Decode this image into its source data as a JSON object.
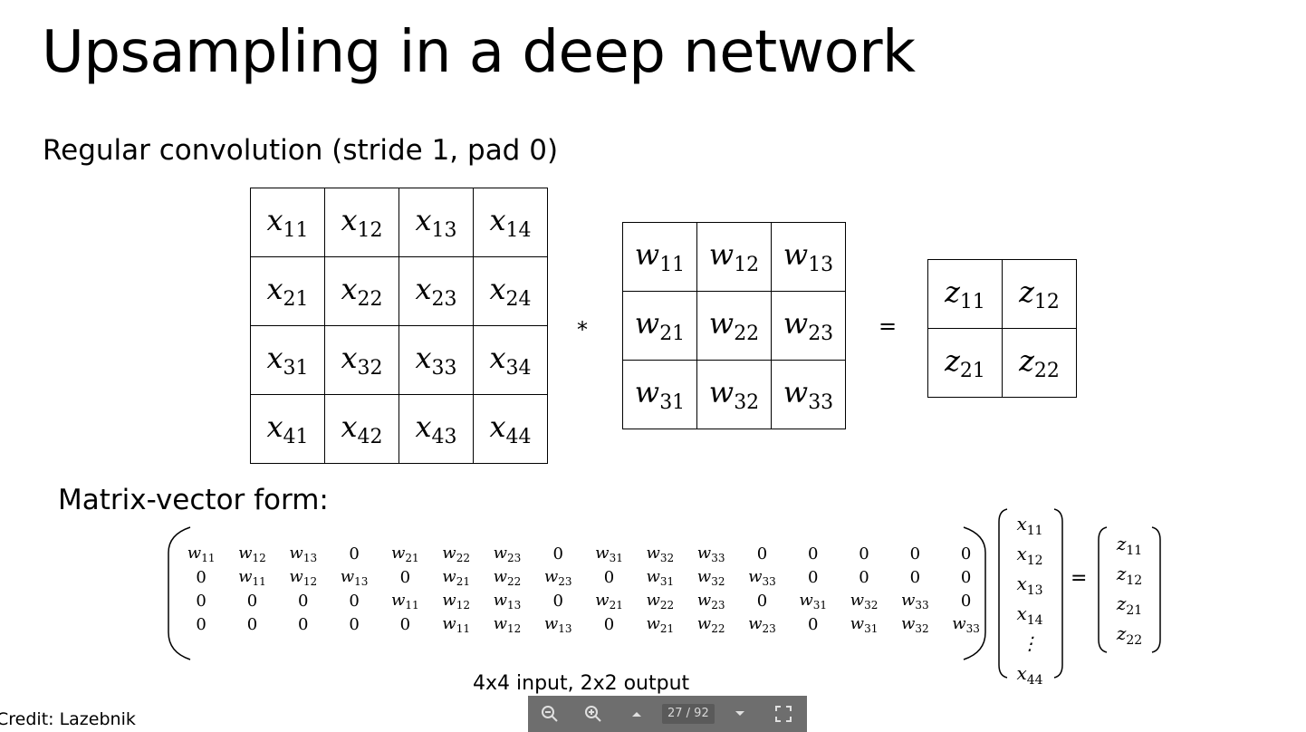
{
  "slide": {
    "title": "Upsampling in a deep network",
    "subtitle": "Regular convolution (stride 1, pad 0)",
    "matrix_vector_title": "Matrix-vector form:",
    "caption": "4x4 input, 2x2 output",
    "credit": "Credit: Lazebnik"
  },
  "input_grid": [
    [
      "11",
      "12",
      "13",
      "14"
    ],
    [
      "21",
      "22",
      "23",
      "24"
    ],
    [
      "31",
      "32",
      "33",
      "34"
    ],
    [
      "41",
      "42",
      "43",
      "44"
    ]
  ],
  "kernel_grid": [
    [
      "11",
      "12",
      "13"
    ],
    [
      "21",
      "22",
      "23"
    ],
    [
      "31",
      "32",
      "33"
    ]
  ],
  "output_grid": [
    [
      "11",
      "12"
    ],
    [
      "21",
      "22"
    ]
  ],
  "operators": {
    "conv": "*",
    "equals_top": "=",
    "equals_bottom": "="
  },
  "matrix": [
    [
      "w11",
      "w12",
      "w13",
      "0",
      "w21",
      "w22",
      "w23",
      "0",
      "w31",
      "w32",
      "w33",
      "0",
      "0",
      "0",
      "0",
      "0"
    ],
    [
      "0",
      "w11",
      "w12",
      "w13",
      "0",
      "w21",
      "w22",
      "w23",
      "0",
      "w31",
      "w32",
      "w33",
      "0",
      "0",
      "0",
      "0"
    ],
    [
      "0",
      "0",
      "0",
      "0",
      "w11",
      "w12",
      "w13",
      "0",
      "w21",
      "w22",
      "w23",
      "0",
      "w31",
      "w32",
      "w33",
      "0"
    ],
    [
      "0",
      "0",
      "0",
      "0",
      "0",
      "w11",
      "w12",
      "w13",
      "0",
      "w21",
      "w22",
      "w23",
      "0",
      "w31",
      "w32",
      "w33"
    ]
  ],
  "x_vector": [
    "x11",
    "x12",
    "x13",
    "x14",
    "⋮",
    "x44"
  ],
  "z_vector": [
    "z11",
    "z12",
    "z21",
    "z22"
  ],
  "toolbar": {
    "page_indicator": "27 / 92",
    "icons": [
      "zoom-out-icon",
      "zoom-in-icon",
      "page-up-icon",
      "page-down-icon",
      "fullscreen-icon"
    ]
  }
}
